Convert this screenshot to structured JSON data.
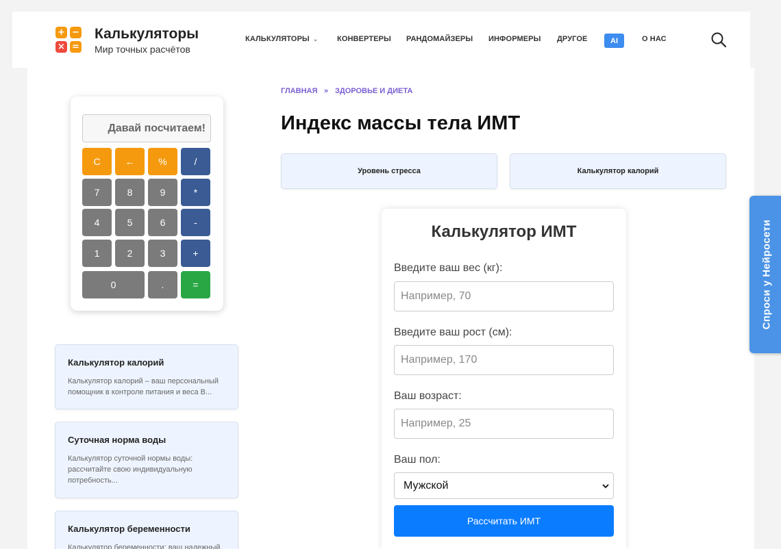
{
  "header": {
    "brand_title": "Калькуляторы",
    "brand_subtitle": "Мир точных расчётов",
    "logo_symbols": [
      "+",
      "−",
      "×",
      "="
    ],
    "nav": [
      {
        "label": "КАЛЬКУЛЯТОРЫ",
        "has_dropdown": true
      },
      {
        "label": "КОНВЕРТЕРЫ"
      },
      {
        "label": "РАНДОМАЙЗЕРЫ"
      },
      {
        "label": "ИНФОРМЕРЫ"
      },
      {
        "label": "ДРУГОЕ"
      },
      {
        "label": "AI"
      },
      {
        "label": "О НАС"
      }
    ],
    "search_icon": "search-icon"
  },
  "calculator": {
    "display": "Давай посчитаем!",
    "keys": [
      "C",
      "←",
      "%",
      "/",
      "7",
      "8",
      "9",
      "*",
      "4",
      "5",
      "6",
      "-",
      "1",
      "2",
      "3",
      "+",
      "0",
      ".",
      "="
    ]
  },
  "sidebar": {
    "cards": [
      {
        "title": "Калькулятор калорий",
        "text": "Калькулятор калорий – ваш персональный помощник в контроле питания и веса В..."
      },
      {
        "title": "Суточная норма воды",
        "text": "Калькулятор суточной нормы воды: рассчитайте свою индивидуальную потребность..."
      },
      {
        "title": "Калькулятор беременности",
        "text": "Калькулятор беременности: ваш надежный"
      }
    ]
  },
  "breadcrumb": {
    "home": "ГЛАВНАЯ",
    "separator": "»",
    "section": "ЗДОРОВЬЕ И ДИЕТА"
  },
  "page_title": "Индекс массы тела ИМТ",
  "related": [
    "Уровень стресса",
    "Калькулятор калорий"
  ],
  "bmi_form": {
    "title": "Калькулятор ИМТ",
    "weight_label": "Введите ваш вес (кг):",
    "weight_placeholder": "Например, 70",
    "height_label": "Введите ваш рост (см):",
    "height_placeholder": "Например, 170",
    "age_label": "Ваш возраст:",
    "age_placeholder": "Например, 25",
    "gender_label": "Ваш пол:",
    "gender_value": "Мужской",
    "submit_label": "Рассчитать ИМТ"
  },
  "side_tab": "Спроси у Нейросети",
  "colors": {
    "accent_blue": "#0a7cff",
    "orange": "#f59a0e",
    "calc_blue": "#3a5b94",
    "calc_green": "#2aa745",
    "breadcrumb": "#7a5fd0",
    "side_tab": "#4a93e6"
  }
}
